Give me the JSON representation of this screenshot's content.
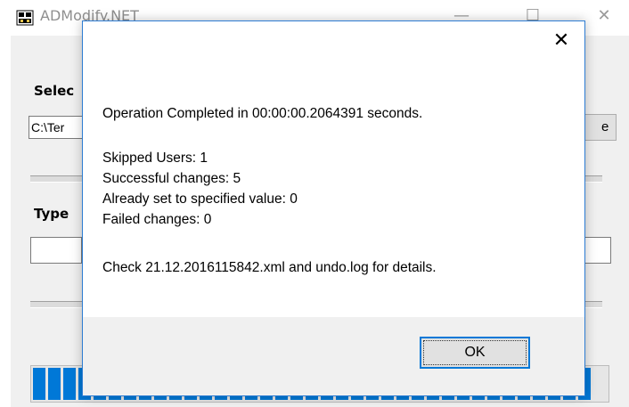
{
  "parent_window": {
    "title": "ADModify.NET",
    "minimize_glyph": "—",
    "maximize_glyph": "☐",
    "close_glyph": "✕",
    "select_label": "Selec",
    "path_value": "C:\\Ter",
    "browse_label": "e",
    "type_label": "Type",
    "progress_percent": 100
  },
  "dialog": {
    "close_glyph": "✕",
    "message_line1": "Operation Completed in 00:00:00.2064391 seconds.",
    "skipped_users": "Skipped Users: 1",
    "successful_changes": "Successful changes: 5",
    "already_set": "Already set to specified value: 0",
    "failed_changes": "Failed changes: 0",
    "check_line": "Check 21.12.2016115842.xml and undo.log for details.",
    "ok_label": "OK"
  },
  "colors": {
    "accent": "#0078d7",
    "dialog_border": "#2e7dd3",
    "footer_bg": "#f0f0f0"
  }
}
